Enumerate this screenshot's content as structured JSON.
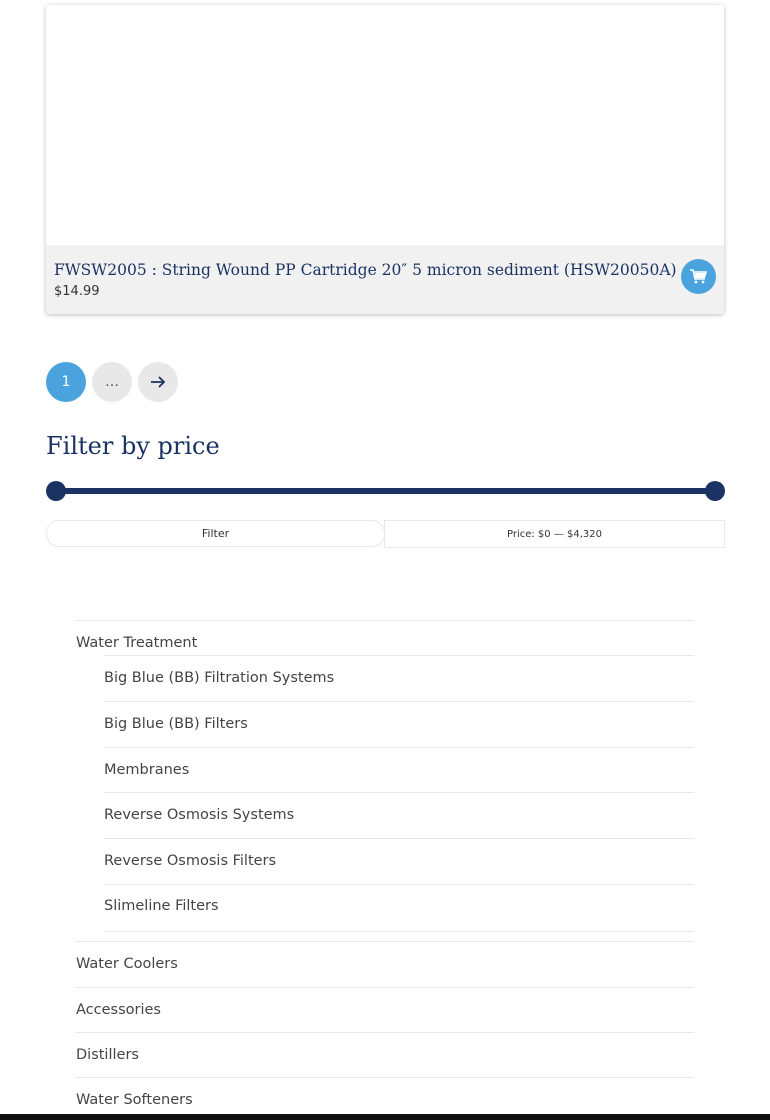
{
  "product": {
    "title": "FWSW2005 : String Wound PP Cartridge 20″ 5 micron sediment (HSW20050A)",
    "price": "$14.99"
  },
  "pagination": {
    "current": "1",
    "ellipsis": "…"
  },
  "price_filter": {
    "title": "Filter by price",
    "button_label": "Filter",
    "price_text": "Price: $0 — $4,320",
    "range_min_fraction": 0,
    "range_max_fraction": 1
  },
  "categories": {
    "parent": "Water Treatment",
    "children": [
      "Big Blue (BB) Filtration Systems",
      "Big Blue (BB) Filters",
      "Membranes",
      "Reverse Osmosis Systems",
      "Reverse Osmosis Filters",
      "Slimeline Filters"
    ],
    "others": [
      "Water Coolers",
      "Accessories",
      "Distillers",
      "Water Softeners"
    ]
  },
  "colors": {
    "accent": "#4aa3dd",
    "navy": "#1b3363"
  }
}
